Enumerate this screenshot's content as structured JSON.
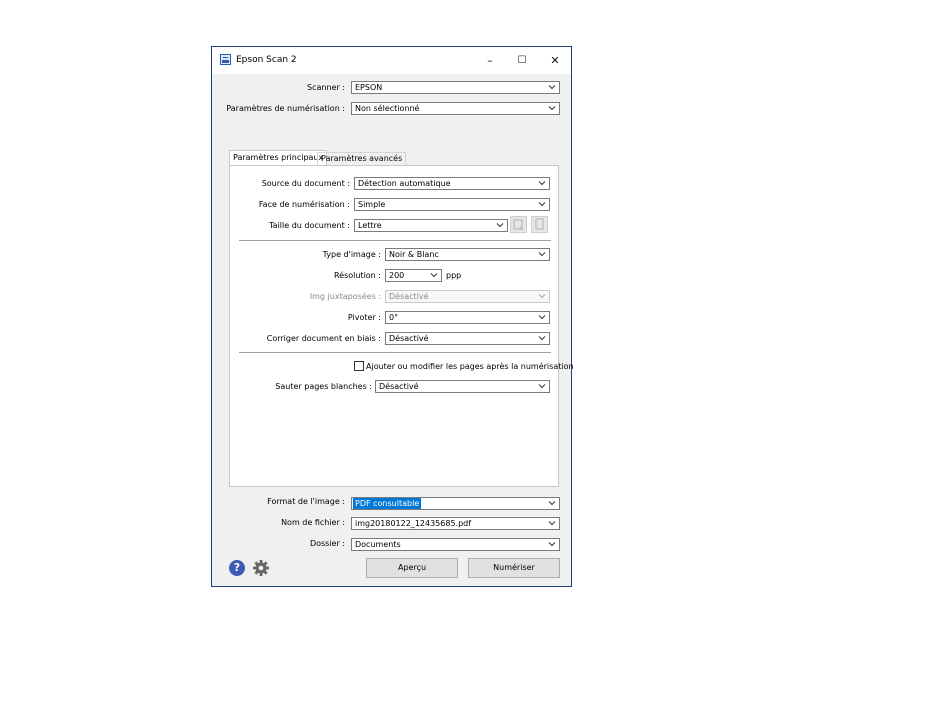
{
  "window": {
    "title": "Epson Scan 2",
    "minimize": "–",
    "maximize": "☐",
    "close": "✕"
  },
  "top": {
    "scanner_label": "Scanner :",
    "scanner_value": "EPSON",
    "params_label": "Paramètres de numérisation :",
    "params_value": "Non sélectionné"
  },
  "tabs": {
    "main": "Paramètres principaux",
    "advanced": "Paramètres avancés"
  },
  "main": {
    "source_label": "Source du document :",
    "source_value": "Détection automatique",
    "face_label": "Face de numérisation :",
    "face_value": "Simple",
    "size_label": "Taille du document :",
    "size_value": "Lettre",
    "type_label": "Type d'image :",
    "type_value": "Noir & Blanc",
    "resolution_label": "Résolution :",
    "resolution_value": "200",
    "resolution_unit": "ppp",
    "stitch_label": "Img juxtaposées :",
    "stitch_value": "Désactivé",
    "rotate_label": "Pivoter :",
    "rotate_value": "0°",
    "skew_label": "Corriger document en biais :",
    "skew_value": "Désactivé",
    "add_pages_label": "Ajouter ou modifier les pages après la numérisation",
    "skip_blank_label": "Sauter pages blanches :",
    "skip_blank_value": "Désactivé"
  },
  "bottom": {
    "format_label": "Format de l'image :",
    "format_value": "PDF consultable",
    "filename_label": "Nom de fichier :",
    "filename_value": "img20180122_12435685.pdf",
    "folder_label": "Dossier :",
    "folder_value": "Documents",
    "preview_button": "Aperçu",
    "scan_button": "Numériser",
    "help_icon_glyph": "?"
  },
  "colors": {
    "selection": "#0078d7",
    "help_icon": "#3d5ab6",
    "window_border": "#1f3f7a"
  },
  "icons": [
    "app-scanner-icon",
    "chevron-down-icon",
    "help-icon",
    "gear-icon",
    "document-size-auto-icon",
    "document-size-custom-icon"
  ]
}
